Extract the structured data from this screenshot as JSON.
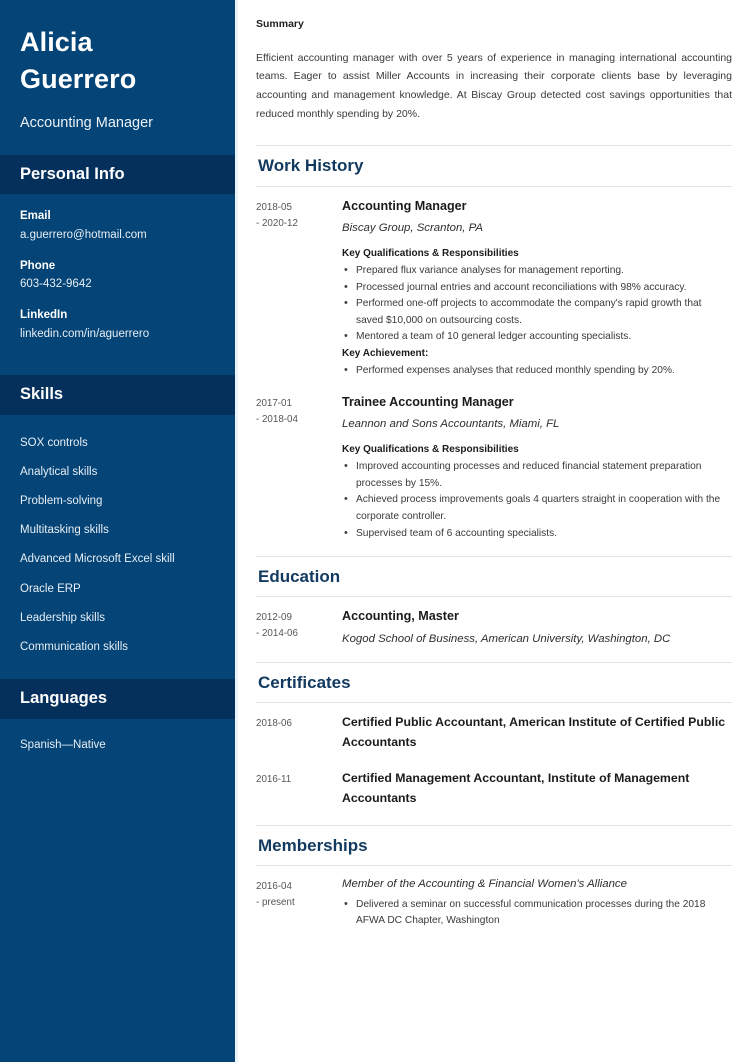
{
  "colors": {
    "sidebar_bg": "#044476",
    "sidebar_heading_bg": "#05305b",
    "section_heading": "#12395f",
    "body_text": "#3a3a3a"
  },
  "sidebar": {
    "name_first": "Alicia",
    "name_last": "Guerrero",
    "job_title": "Accounting Manager",
    "personal_info": {
      "heading": "Personal Info",
      "items": [
        {
          "label": "Email",
          "value": "a.guerrero@hotmail.com"
        },
        {
          "label": "Phone",
          "value": "603-432-9642"
        },
        {
          "label": "LinkedIn",
          "value": "linkedin.com/in/aguerrero"
        }
      ]
    },
    "skills": {
      "heading": "Skills",
      "items": [
        "SOX controls",
        "Analytical skills",
        "Problem-solving",
        "Multitasking skills",
        "Advanced Microsoft Excel skill",
        "Oracle ERP",
        "Leadership skills",
        "Communication skills"
      ]
    },
    "languages": {
      "heading": "Languages",
      "items": [
        "Spanish—Native"
      ]
    }
  },
  "main": {
    "summary": {
      "label": "Summary",
      "text": "Efficient accounting manager with over 5 years of experience in managing international accounting teams. Eager to assist Miller Accounts in increasing their corporate clients base by leveraging accounting and management knowledge. At Biscay Group detected cost savings opportunities that reduced monthly spending by 20%."
    },
    "work_history": {
      "heading": "Work History",
      "entries": [
        {
          "date_start": "2018-05",
          "date_end": "- 2020-12",
          "title": "Accounting Manager",
          "organization": "Biscay Group, Scranton, PA",
          "quals_label": "Key Qualifications & Responsibilities",
          "quals": [
            "Prepared flux variance analyses for management reporting.",
            "Processed journal entries and account reconciliations with 98% accuracy.",
            "Performed one-off projects to accommodate the company's rapid growth that saved $10,000 on outsourcing costs.",
            "Mentored a team of 10 general ledger accounting specialists."
          ],
          "achievement_label": "Key Achievement:",
          "achievements": [
            "Performed expenses analyses that reduced monthly spending by 20%."
          ]
        },
        {
          "date_start": "2017-01",
          "date_end": "- 2018-04",
          "title": "Trainee Accounting Manager",
          "organization": "Leannon and Sons Accountants, Miami, FL",
          "quals_label": "Key Qualifications & Responsibilities",
          "quals": [
            "Improved accounting processes and reduced financial statement preparation processes by 15%.",
            "Achieved process improvements goals 4 quarters straight in cooperation with the corporate controller.",
            "Supervised team of 6 accounting specialists."
          ],
          "achievement_label": "",
          "achievements": []
        }
      ]
    },
    "education": {
      "heading": "Education",
      "entries": [
        {
          "date_start": "2012-09",
          "date_end": "- 2014-06",
          "title": "Accounting, Master",
          "organization": "Kogod School of Business, American University, Washington, DC"
        }
      ]
    },
    "certificates": {
      "heading": "Certificates",
      "entries": [
        {
          "date": "2018-06",
          "title": "Certified Public Accountant, American Institute of Certified Public Accountants"
        },
        {
          "date": "2016-11",
          "title": "Certified Management Accountant, Institute of Management Accountants"
        }
      ]
    },
    "memberships": {
      "heading": "Memberships",
      "entries": [
        {
          "date_start": "2016-04",
          "date_end": "- present",
          "title": "Member of the Accounting & Financial Women's Alliance",
          "bullets": [
            "Delivered a seminar on successful communication processes during the 2018 AFWA DC Chapter, Washington"
          ]
        }
      ]
    }
  }
}
